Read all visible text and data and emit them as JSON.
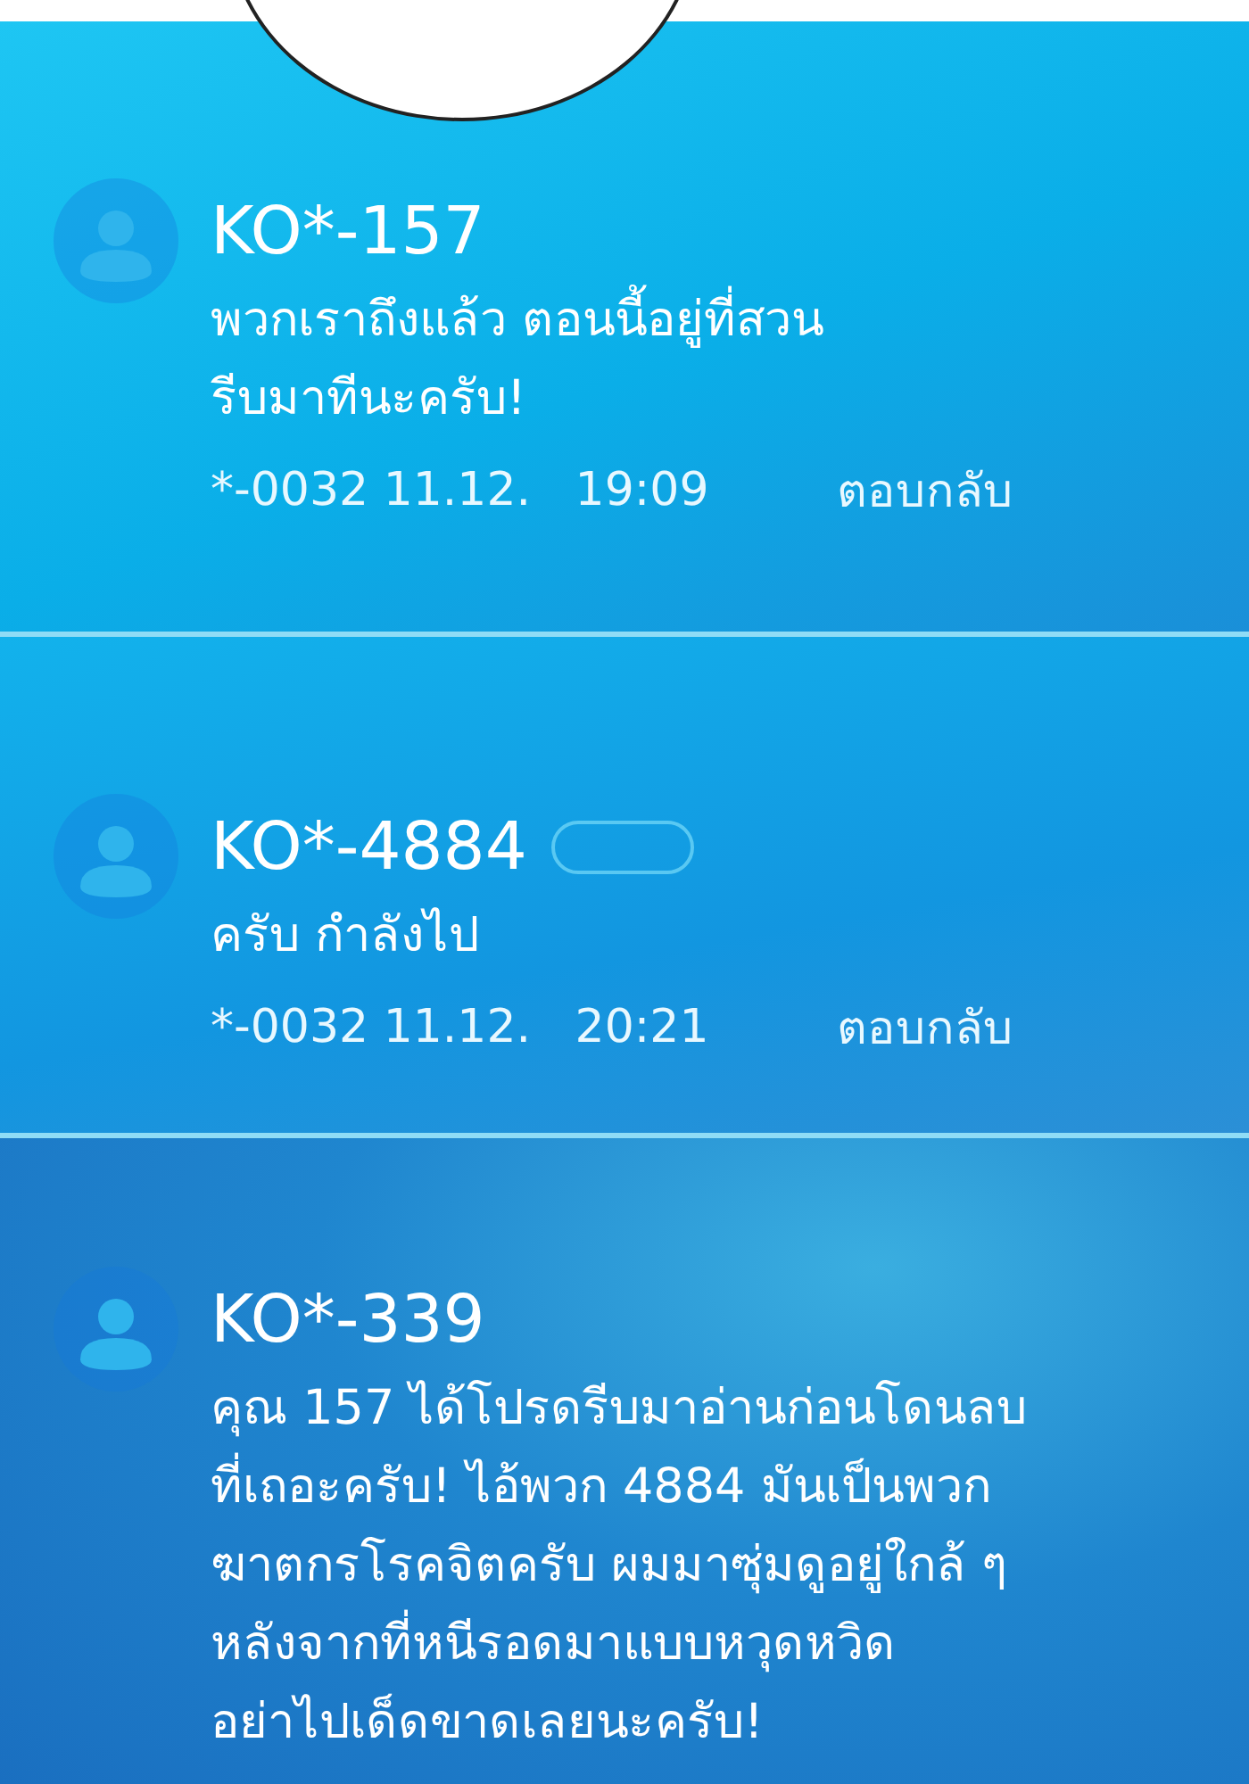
{
  "messages": [
    {
      "sender": "KO*-157",
      "text": "พวกเราถึงแล้ว ตอนนี้อยู่ที่สวน\nรีบมาทีนะครับ!",
      "meta": "*-0032 11.12.   19:09",
      "reply": "ตอบกลับ",
      "has_tag": false
    },
    {
      "sender": "KO*-4884",
      "text": "ครับ กำลังไป",
      "meta": "*-0032 11.12.   20:21",
      "reply": "ตอบกลับ",
      "has_tag": true
    },
    {
      "sender": "KO*-339",
      "text": "คุณ 157 ได้โปรดรีบมาอ่านก่อนโดนลบ\nที่เถอะครับ! ไอ้พวก 4884 มันเป็นพวก\nฆาตกรโรคจิตครับ ผมมาซุ่มดูอยู่ใกล้ ๆ\nหลังจากที่หนีรอดมาแบบหวุดหวิด\nอย่าไปเด็ดขาดเลยนะครับ!",
      "has_tag": false
    }
  ]
}
